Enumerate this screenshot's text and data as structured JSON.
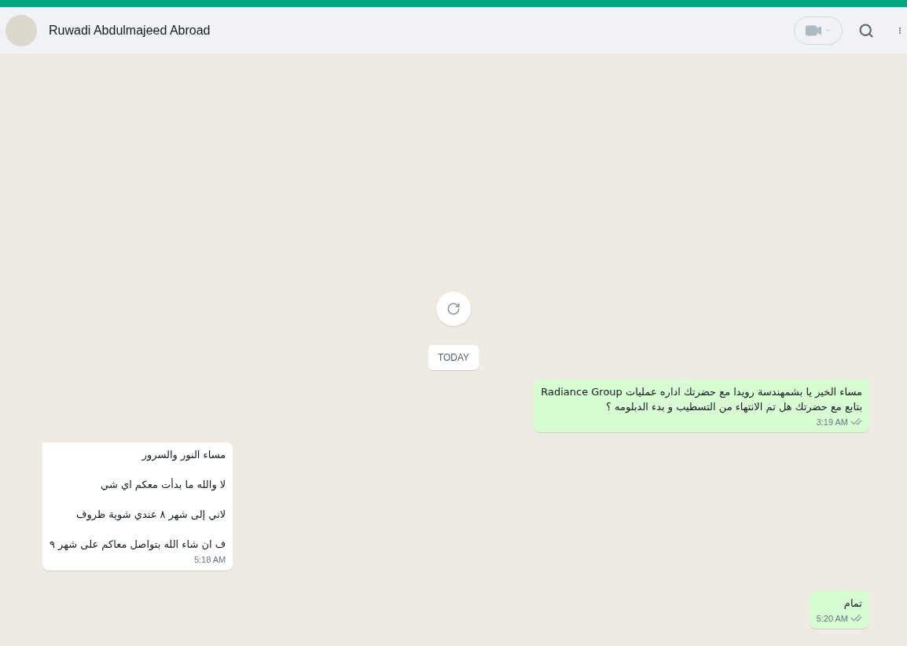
{
  "header": {
    "contact_name": "Ruwadi Abdulmajeed Abroad"
  },
  "date_chip": "TODAY",
  "messages": [
    {
      "kind": "out",
      "lines": [
        "مساء الخير يا بشمهندسة رويدا مع  حضرتك اداره عمليات Radiance Group",
        "بتابع مع حضرتك هل تم الانتهاء من التسطيب و بدء الدبلومه ؟"
      ],
      "time": "3:19 AM",
      "read": false
    },
    {
      "kind": "in",
      "lines": [
        "مساء النور والسرور",
        "لا والله ما بدأت معكم اي شي",
        "لاني إلى شهر ٨ عندي شوية ظروف",
        "ف ان شاء الله بتواصل معاكم على شهر ٩"
      ],
      "time": "5:18 AM"
    },
    {
      "kind": "out",
      "lines": [
        "تمام"
      ],
      "time": "5:20 AM",
      "read": false
    }
  ]
}
